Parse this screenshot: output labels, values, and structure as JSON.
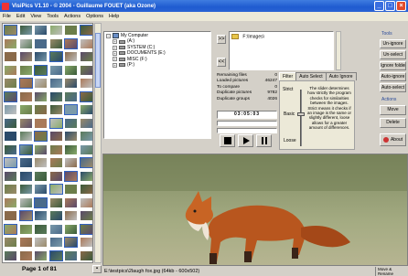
{
  "window": {
    "title": "VisiPics V1.10 - © 2004 - Guillaume FOUET (aka Ozone)"
  },
  "menu": [
    "File",
    "Edit",
    "View",
    "Tools",
    "Actions",
    "Options",
    "Help"
  ],
  "thumbnails": {
    "page_label": "Page 1 of 81"
  },
  "tree": {
    "root": "My Computer",
    "items": [
      "(A:)",
      "SYSTEM (C:)",
      "DOCUMENTS (E:)",
      "MISC (F:)",
      "(P:)"
    ]
  },
  "folders": {
    "add_label": ">>",
    "remove_label": "<<",
    "selected": "F:\\Images\\"
  },
  "stats": {
    "remaining_label": "Remaining files",
    "remaining_value": "0",
    "loaded_label": "Loaded pictures",
    "loaded_value": "46247",
    "compare_label": "To compare",
    "compare_value": "0",
    "duplicate_pictures_label": "Duplicate pictures",
    "duplicate_pictures_value": "9782",
    "duplicate_groups_label": "Duplicate groups",
    "duplicate_groups_value": "4026",
    "time": "03:05:03"
  },
  "tabs": [
    "Filter",
    "Auto Select",
    "Auto Ignore"
  ],
  "filter": {
    "strict": "Strict",
    "basic": "Basic",
    "loose": "Loose",
    "description": "The slider determines how strictly the program checks for similarities between the images. Strict means it checks if an image is the same or slightly different, loose allows for a greater amount of differences."
  },
  "right_panel": {
    "tools_label": "Tools",
    "unignore": "Un-ignore",
    "unselect": "Un-select",
    "ignore_folder": "Ignore folder",
    "auto_ignore": "Auto-ignore",
    "auto_select": "Auto-select",
    "actions_label": "Actions",
    "move": "Move",
    "delete": "Delete",
    "about": "About"
  },
  "status": {
    "path": "E:\\testpics\\2laugh fox.jpg (64kb - 600x502)",
    "right": "Move & Rename"
  },
  "colors": {
    "titlebar": "#1f5bd0",
    "panel": "#d4d0c8",
    "label": "#2a4a9a"
  }
}
